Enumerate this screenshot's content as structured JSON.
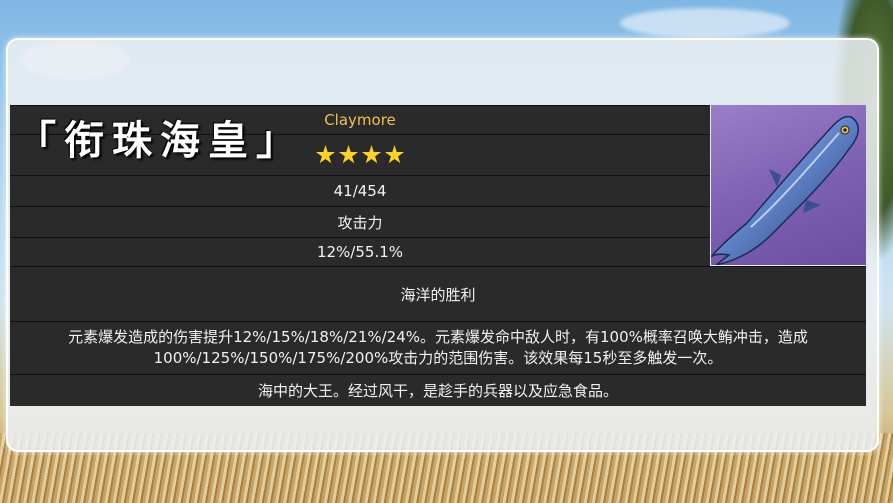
{
  "weapon": {
    "name": "「衔珠海皇」",
    "type": "Claymore",
    "rarity_stars": 4,
    "base_atk": "41/454",
    "substat_name": "攻击力",
    "substat_value": "12%/55.1%",
    "passive_name": "海洋的胜利",
    "passive_description": "元素爆发造成的伤害提升12%/15%/18%/21%/24%。元素爆发命中敌人时，有100%概率召唤大鲔冲击，造成100%/125%/150%/175%/200%攻击力的范围伤害。该效果每15秒至多触发一次。",
    "flavor_text": "海中的大王。经过风干，是趁手的兵器以及应急食品。",
    "image_icon": "fish-icon"
  },
  "colors": {
    "type_label": "#f2c14e",
    "star": "#ffd21f",
    "row_background": "#2a2a2a",
    "image_background": "#8a6dbd"
  }
}
